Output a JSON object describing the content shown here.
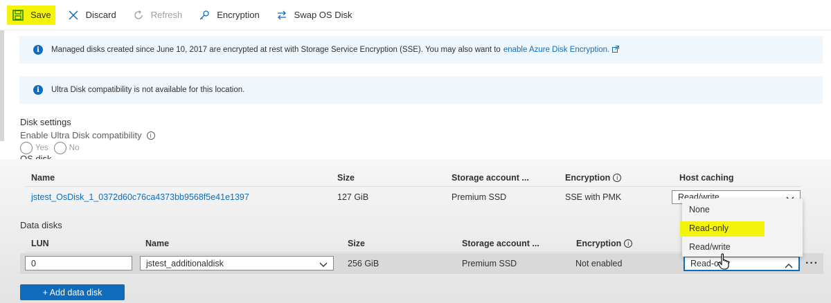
{
  "toolbar": {
    "save": "Save",
    "discard": "Discard",
    "refresh": "Refresh",
    "encryption": "Encryption",
    "swap": "Swap OS Disk"
  },
  "banners": {
    "sse_text": "Managed disks created since June 10, 2017 are encrypted at rest with Storage Service Encryption (SSE). You may also want to",
    "sse_link": "enable Azure Disk Encryption.",
    "ultra_text": "Ultra Disk compatibility is not available for this location."
  },
  "disk_settings": {
    "title": "Disk settings",
    "ultra_label": "Enable Ultra Disk compatibility",
    "yes": "Yes",
    "no": "No"
  },
  "os_disk": {
    "title": "OS disk",
    "headers": {
      "name": "Name",
      "size": "Size",
      "storage": "Storage account ...",
      "encryption": "Encryption",
      "caching": "Host caching"
    },
    "row": {
      "name": "jstest_OsDisk_1_0372d60c76ca4373bb9568f5e41e1397",
      "size": "127 GiB",
      "storage": "Premium SSD",
      "encryption": "SSE with PMK",
      "caching": "Read/write"
    },
    "caching_options": [
      "None",
      "Read-only",
      "Read/write"
    ]
  },
  "data_disks": {
    "title": "Data disks",
    "headers": {
      "lun": "LUN",
      "name": "Name",
      "size": "Size",
      "storage": "Storage account ...",
      "encryption": "Encryption"
    },
    "row": {
      "lun": "0",
      "name": "jstest_additionaldisk",
      "size": "256 GiB",
      "storage": "Premium SSD",
      "encryption": "Not enabled",
      "caching": "Read-only"
    },
    "more": "···",
    "add_button": "+ Add data disk"
  },
  "colors": {
    "accent": "#0f6cbd",
    "highlight": "#f4f40a",
    "banner_bg": "#eff6fc"
  }
}
